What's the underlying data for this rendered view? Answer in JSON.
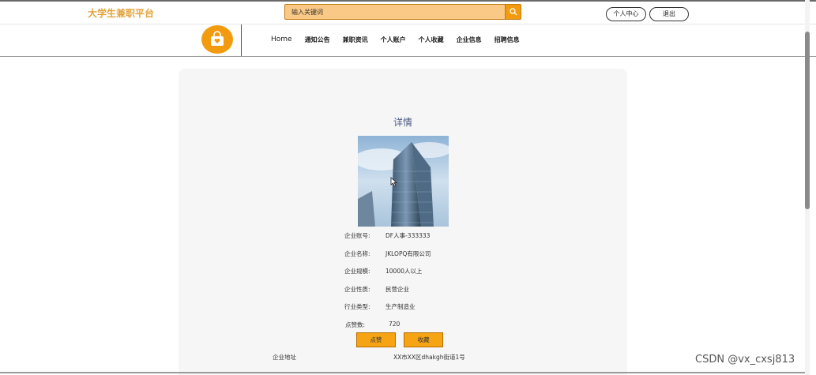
{
  "header": {
    "brand": "大学生兼职平台",
    "search_placeholder": "输入关键词",
    "user_center": "个人中心",
    "logout": "退出"
  },
  "nav": {
    "items": [
      "Home",
      "通知公告",
      "兼职资讯",
      "个人账户",
      "个人收藏",
      "企业信息",
      "招聘信息"
    ]
  },
  "detail": {
    "title": "详情",
    "fields": [
      {
        "label": "企业账号:",
        "value": "DF人事-333333"
      },
      {
        "label": "企业名称:",
        "value": "JKLOPQ有限公司"
      },
      {
        "label": "企业规模:",
        "value": "10000人以上"
      },
      {
        "label": "企业性质:",
        "value": "民营企业"
      },
      {
        "label": "行业类型:",
        "value": "生产制造业"
      },
      {
        "label": "点赞数:",
        "value": "720"
      }
    ],
    "like_button": "点赞",
    "favorite_button": "收藏",
    "address_label": "企业地址",
    "address_value": "XX市XX区dhakgh街道1号"
  },
  "watermark": "CSDN @vx_cxsj813",
  "colors": {
    "accent": "#f29b0f",
    "brand_text": "#e2a33a",
    "title_text": "#4a5a84"
  },
  "icons": [
    "search-icon",
    "shopping-bag-heart-icon",
    "mouse-cursor-icon"
  ]
}
